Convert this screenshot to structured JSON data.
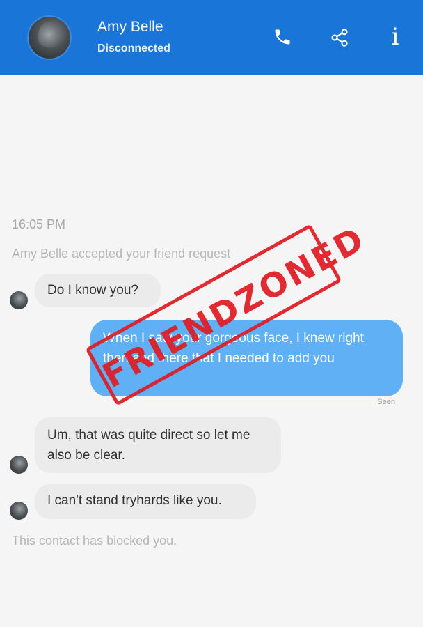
{
  "header": {
    "contact_name": "Amy Belle",
    "status": "Disconnected",
    "background_color": "#1976d8",
    "icons": [
      "phone-icon",
      "share-icon",
      "info-icon"
    ],
    "info_glyph": "i"
  },
  "conversation": {
    "timestamp": "16:05 PM",
    "system_accept": "Amy Belle accepted your friend request",
    "messages": [
      {
        "sender": "contact",
        "text": "Do I know you?"
      },
      {
        "sender": "me",
        "text": "When I saw your gorgeous face, I knew right then and there that I needed to add you",
        "receipt": "Seen"
      },
      {
        "sender": "contact",
        "text": "Um, that was quite direct so let me also be clear."
      },
      {
        "sender": "contact",
        "text": "I can't stand tryhards like you."
      }
    ],
    "system_blocked": "This contact has blocked you."
  },
  "overlay": {
    "stamp_text": "FRIENDZONED",
    "stamp_color": "#e11b24"
  },
  "colors": {
    "incoming_bubble": "#ebebeb",
    "outgoing_bubble": "#5fb0f5",
    "background": "#f5f5f5"
  }
}
